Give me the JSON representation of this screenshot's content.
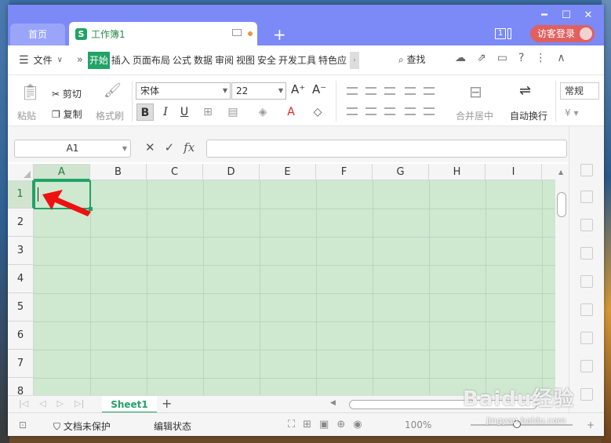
{
  "titlebar": {
    "home_tab": "首页",
    "doc_tab": "工作簿1",
    "doc_logo": "S",
    "badge_count": "1",
    "login": "访客登录",
    "controls": [
      "━",
      "☐",
      "✕"
    ]
  },
  "menubar": {
    "file": "文件",
    "tabs": [
      "开始",
      "插入",
      "页面布局",
      "公式",
      "数据",
      "审阅",
      "视图",
      "安全",
      "开发工具",
      "特色应"
    ],
    "search": "查找"
  },
  "ribbon": {
    "paste": "粘贴",
    "cut": "剪切",
    "copy": "复制",
    "format_painter": "格式刷",
    "font_name": "宋体",
    "font_size": "22",
    "merge_center": "合并居中",
    "wrap_text": "自动换行",
    "number_format": "常规"
  },
  "formula": {
    "namebox": "A1",
    "fx": "fx"
  },
  "grid": {
    "columns": [
      "A",
      "B",
      "C",
      "D",
      "E",
      "F",
      "G",
      "H",
      "I"
    ],
    "rows": [
      "1",
      "2",
      "3",
      "4",
      "5",
      "6",
      "7",
      "8"
    ],
    "active_cell": "A1"
  },
  "sheets": {
    "tabs": [
      "Sheet1"
    ]
  },
  "status": {
    "protect": "文档未保护",
    "mode": "编辑状态",
    "zoom": "100%"
  },
  "watermark": {
    "text": "Baidu经验",
    "sub": "jingyan.baidu.com"
  }
}
